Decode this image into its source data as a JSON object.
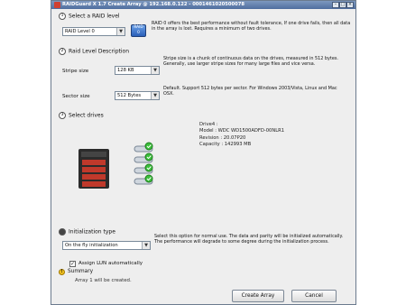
{
  "window": {
    "title": "RAIDGuard X 1.7 Create Array @ 192.168.0.122 - 0001461020500078",
    "min": "–",
    "max": "□",
    "close": "×"
  },
  "section1": {
    "number": "1",
    "title": "Select a RAID level",
    "select_value": "RAID Level 0",
    "badge_line1": "RAID",
    "badge_line2": "0",
    "description": "RAID 0 offers the best performance without fault tolerance, If one drive fails, then all data in the array is lost. Requires a minimum of two drives."
  },
  "section2": {
    "number": "2",
    "title": "Raid Level Description",
    "stripe_label": "Stripe size",
    "stripe_value": "128 KB",
    "stripe_desc": "Stripe size is a chunk of continuous data on the drives, measured in 512 bytes. Generally, use larger stripe sizes for many large files and vice versa.",
    "sector_label": "Sector size",
    "sector_value": "512 Bytes",
    "sector_desc": "Default. Support 512 bytes per sector. For Windows 2003/Vista, Linux and Mac OSX."
  },
  "section3": {
    "number": "3",
    "title": "Select drives",
    "drive_name": "Drive4 :",
    "drive_model": "Model : WDC WD1500ADFD-00NLR1",
    "drive_revision": "Revision : 20.07P20",
    "drive_capacity": "Capacity : 142993 MB"
  },
  "section4": {
    "title": "Initialization type",
    "select_value": "On the fly initialization",
    "description": "Select this option for normal use. The data and parity will be initialized automatically. The performance will degrade to some degree during the initialization process.",
    "checkbox_label": "Assign LUN automatically",
    "checkbox_mark": "✓"
  },
  "summary": {
    "label": "Summary",
    "icon": "!",
    "text": "Array 1 will be created."
  },
  "buttons": {
    "create": "Create Array",
    "cancel": "Cancel"
  },
  "colors": {
    "titlebar": "#5a78a8",
    "badge": "#2a5fb8",
    "check_green": "#3cbf3c",
    "enclosure": "#2b2b2b",
    "enclosure_red": "#c0392b"
  }
}
